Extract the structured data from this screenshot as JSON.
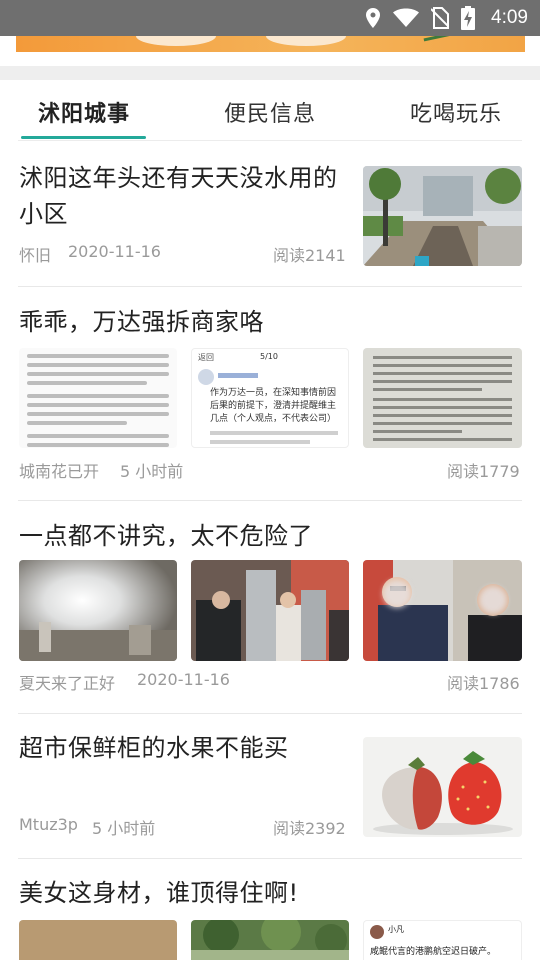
{
  "status_bar": {
    "time": "4:09"
  },
  "tabs": [
    {
      "label": "沭阳城事",
      "active": true
    },
    {
      "label": "便民信息",
      "active": false
    },
    {
      "label": "吃喝玩乐",
      "active": false
    }
  ],
  "colors": {
    "accent": "#23a99a",
    "status_bar": "#6f6f6f",
    "meta_text": "#9a9a9a"
  },
  "articles": [
    {
      "title": "沭阳这年头还有天天没水用的小区",
      "author": "怀旧",
      "date": "2020-11-16",
      "reads": "阅读2141"
    },
    {
      "title": "乖乖，万达强拆商家咯",
      "author": "城南花已开",
      "date": "5 小时前",
      "reads": "阅读1779",
      "image_texts": {
        "back": "返回",
        "page": "5/10",
        "caption": "作为万达一员，在深知事情前因后果的前提下，澄清并提醒维主几点（个人观点，不代表公司）"
      }
    },
    {
      "title": "一点都不讲究，太不危险了",
      "author": "夏天来了正好",
      "date": "2020-11-16",
      "reads": "阅读1786"
    },
    {
      "title": "超市保鲜柜的水果不能买",
      "author": "Mtuz3p",
      "date": "5 小时前",
      "reads": "阅读2392"
    },
    {
      "title": "美女这身材，谁顶得住啊!",
      "image_texts": {
        "user": "小凡",
        "caption": "咸鲲代言的港鹏航空迟日破产。"
      }
    }
  ]
}
